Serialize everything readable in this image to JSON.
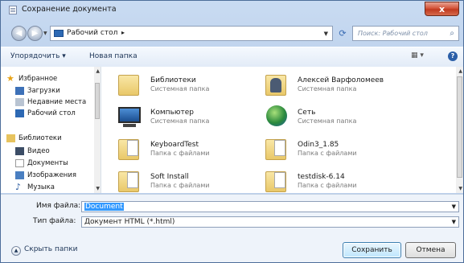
{
  "window": {
    "title": "Сохранение документа",
    "close": "x"
  },
  "address": {
    "location": "Рабочий стол",
    "separator": "▸",
    "search_placeholder": "Поиск: Рабочий стол"
  },
  "toolbar": {
    "organize": "Упорядочить ▾",
    "new_folder": "Новая папка",
    "views": "▦ ▾",
    "help": "?"
  },
  "nav": {
    "favorites": "Избранное",
    "items": [
      "Загрузки",
      "Недавние места",
      "Рабочий стол"
    ],
    "libraries": "Библиотеки",
    "lib_items": [
      "Видео",
      "Документы",
      "Изображения",
      "Музыка"
    ]
  },
  "files": [
    {
      "name": "Библиотеки",
      "type": "Системная папка",
      "icon": "libraries-icon"
    },
    {
      "name": "Алексей Варфоломеев",
      "type": "Системная папка",
      "icon": "user-folder-icon"
    },
    {
      "name": "Компьютер",
      "type": "Системная папка",
      "icon": "computer-icon"
    },
    {
      "name": "Сеть",
      "type": "Системная папка",
      "icon": "network-icon"
    },
    {
      "name": "KeyboardTest",
      "type": "Папка с файлами",
      "icon": "folder-icon"
    },
    {
      "name": "Odin3_1.85",
      "type": "Папка с файлами",
      "icon": "folder-icon"
    },
    {
      "name": "Soft Install",
      "type": "Папка с файлами",
      "icon": "folder-icon"
    },
    {
      "name": "testdisk-6.14",
      "type": "Папка с файлами",
      "icon": "folder-icon"
    }
  ],
  "form": {
    "filename_label": "Имя файла:",
    "filename_value": "Document",
    "filetype_label": "Тип файла:",
    "filetype_value": "Документ HTML (*.html)"
  },
  "footer": {
    "hide_folders": "Скрыть папки",
    "save": "Сохранить",
    "cancel": "Отмена"
  }
}
